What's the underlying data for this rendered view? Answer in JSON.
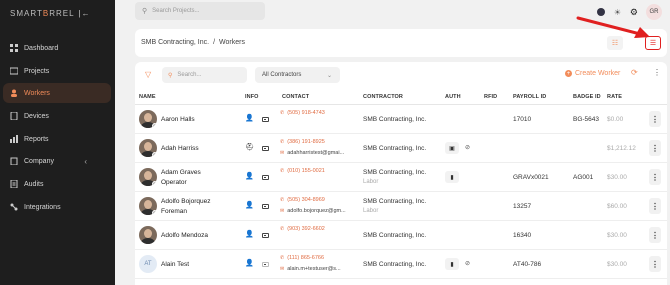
{
  "brand": {
    "prefix": "SMART",
    "b": "B",
    "suffix": "RREL",
    "toggle": "|←"
  },
  "sidebar": {
    "items": [
      {
        "label": "Dashboard",
        "icon": "grid-icon"
      },
      {
        "label": "Projects",
        "icon": "folder-icon"
      },
      {
        "label": "Workers",
        "icon": "user-icon"
      },
      {
        "label": "Devices",
        "icon": "device-icon"
      },
      {
        "label": "Reports",
        "icon": "report-icon"
      },
      {
        "label": "Company",
        "icon": "building-icon"
      },
      {
        "label": "Audits",
        "icon": "audit-icon"
      },
      {
        "label": "Integrations",
        "icon": "integration-icon"
      }
    ],
    "active": "Workers"
  },
  "topbar": {
    "search_placeholder": "Search Projects...",
    "avatar_initials": "GR"
  },
  "header": {
    "company": "SMB Contracting, Inc.",
    "separator": "/",
    "page": "Workers"
  },
  "toolbar": {
    "search_placeholder": "Search...",
    "contractor_filter": "All Contractors",
    "create_label": "Create Worker"
  },
  "table": {
    "columns": [
      "NAME",
      "INFO",
      "CONTACT",
      "CONTRACTOR",
      "AUTH",
      "RFID",
      "PAYROLL ID",
      "BADGE ID",
      "RATE"
    ],
    "rows": [
      {
        "name": "Aaron Halls",
        "sub": "",
        "phone": "(505) 918-4743",
        "email": "",
        "contractor": "SMB Contracting, Inc.",
        "contractor_sub": "",
        "payroll": "17010",
        "badge": "BG-5643",
        "rate": "$0.00"
      },
      {
        "name": "Adah Harriss",
        "sub": "",
        "phone": "(386) 191-8925",
        "email": "adahharristest@gmai...",
        "contractor": "SMB Contracting, Inc.",
        "contractor_sub": "",
        "payroll": "",
        "badge": "",
        "rate": "$1,212.12"
      },
      {
        "name": "Adam Graves",
        "sub": "Operator",
        "phone": "(010) 155-0021",
        "email": "",
        "contractor": "SMB Contracting, Inc.",
        "contractor_sub": "Labor",
        "payroll": "GRAVx0021",
        "badge": "AG001",
        "rate": "$30.00"
      },
      {
        "name": "Adolfo Bojorquez",
        "sub": "Foreman",
        "phone": "(505) 304-8969",
        "email": "adolfo.bojorquez@gm...",
        "contractor": "SMB Contracting, Inc.",
        "contractor_sub": "Labor",
        "payroll": "13257",
        "badge": "",
        "rate": "$60.00"
      },
      {
        "name": "Adolfo Mendoza",
        "sub": "",
        "phone": "(903) 392-6602",
        "email": "",
        "contractor": "SMB Contracting, Inc.",
        "contractor_sub": "",
        "payroll": "16340",
        "badge": "",
        "rate": "$30.00"
      },
      {
        "name": "Alain Test",
        "sub": "",
        "initials": "AT",
        "phone": "(111) 865-6766",
        "email": "alain.m+testuser@s...",
        "contractor": "SMB Contracting, Inc.",
        "contractor_sub": "",
        "payroll": "AT40-786",
        "badge": "",
        "rate": "$30.00"
      }
    ]
  },
  "colors": {
    "accent": "#f28c5a",
    "annotation": "#e02020",
    "sidebar_bg": "#1e1e1e"
  }
}
